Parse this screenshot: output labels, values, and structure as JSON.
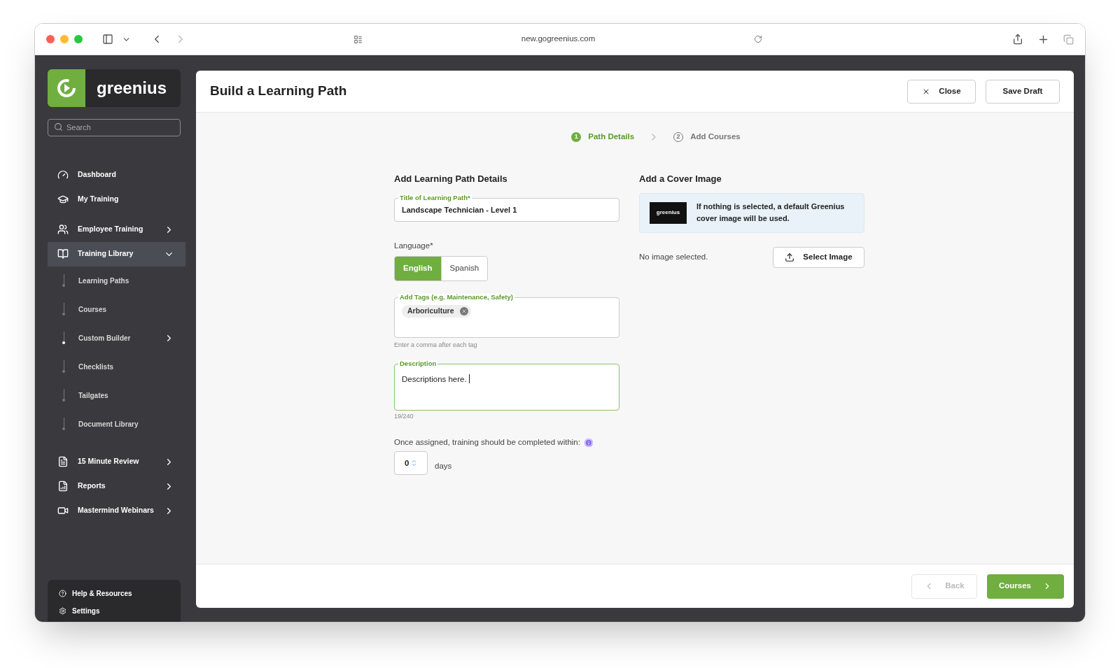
{
  "browser": {
    "url": "new.gogreenius.com"
  },
  "sidebar": {
    "logo": "greenius",
    "search": {
      "placeholder": "Search"
    },
    "items": [
      {
        "label": "Dashboard",
        "kind": "link",
        "selected": false
      },
      {
        "label": "My Training",
        "kind": "link",
        "selected": false
      },
      {
        "label": "Employee Training",
        "kind": "group",
        "expanded": false,
        "selected": false
      },
      {
        "label": "Training Library",
        "kind": "group",
        "expanded": true,
        "selected": true,
        "children": [
          {
            "label": "Learning Paths",
            "kind": "link",
            "selected": false
          },
          {
            "label": "Courses",
            "kind": "link",
            "selected": false
          },
          {
            "label": "Custom Builder",
            "kind": "group",
            "selected": true
          },
          {
            "label": "Checklists",
            "kind": "link",
            "selected": false
          },
          {
            "label": "Tailgates",
            "kind": "link",
            "selected": false
          },
          {
            "label": "Document Library",
            "kind": "link",
            "selected": false
          }
        ]
      },
      {
        "label": "15 Minute Review",
        "kind": "group",
        "expanded": false,
        "selected": false
      },
      {
        "label": "Reports",
        "kind": "group",
        "expanded": false,
        "selected": false
      },
      {
        "label": "Mastermind Webinars",
        "kind": "group",
        "expanded": false,
        "selected": false
      }
    ],
    "footer": [
      {
        "label": "Help & Resources"
      },
      {
        "label": "Settings"
      }
    ]
  },
  "page": {
    "title": "Build a Learning Path",
    "close": "Close",
    "save": "Save Draft",
    "steps": [
      {
        "number": "1",
        "label": "Path Details",
        "selected": true
      },
      {
        "number": "2",
        "label": "Add Courses",
        "selected": false
      }
    ],
    "details": {
      "heading": "Add Learning Path Details",
      "title_field": {
        "label": "Title of Learning Path*",
        "value": "Landscape Technician - Level 1"
      },
      "language": {
        "label": "Language*",
        "options": [
          {
            "label": "English",
            "selected": true
          },
          {
            "label": "Spanish",
            "selected": false
          }
        ]
      },
      "tags": {
        "label": "Add Tags (e.g. Maintenance, Safety)",
        "tags": [
          "Arboriculture"
        ],
        "hint": "Enter a comma after each tag"
      },
      "description": {
        "label": "Description",
        "value": "Descriptions here.",
        "count": "19/240",
        "focused": true
      },
      "deadline": {
        "label": "Once assigned, training should be completed within:",
        "value": "0",
        "unit": "days"
      }
    },
    "cover": {
      "heading": "Add a Cover Image",
      "thumb": "greenius",
      "notice": "If nothing is selected, a default Greenius cover image will be used.",
      "status": "No image selected.",
      "button": "Select Image"
    },
    "footer": {
      "back": {
        "label": "Back",
        "disabled": true
      },
      "next": {
        "label": "Courses",
        "disabled": false
      }
    }
  }
}
